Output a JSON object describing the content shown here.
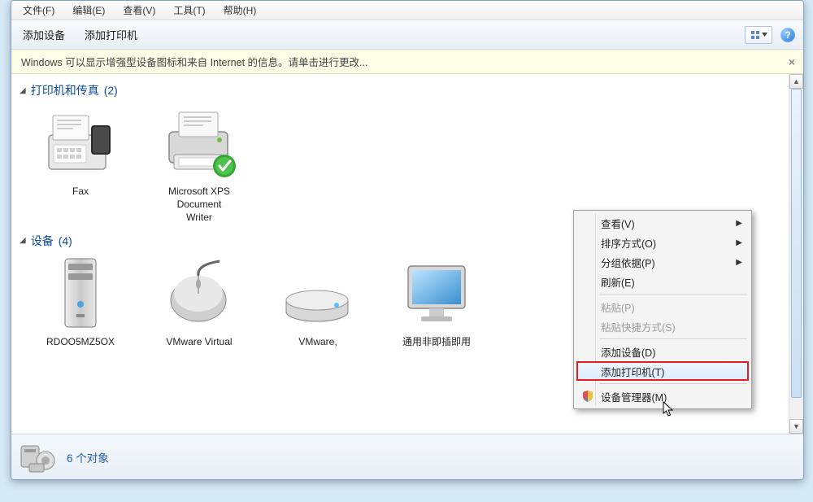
{
  "menu": {
    "file": "文件(F)",
    "edit": "编辑(E)",
    "view": "查看(V)",
    "tools": "工具(T)",
    "help": "帮助(H)"
  },
  "toolbar": {
    "add_device": "添加设备",
    "add_printer": "添加打印机"
  },
  "infobar": {
    "text": "Windows 可以显示增强型设备图标和来自 Internet 的信息。请单击进行更改...",
    "close": "×"
  },
  "groups": {
    "printers": {
      "label": "打印机和传真",
      "count": "(2)"
    },
    "devices": {
      "label": "设备",
      "count": "(4)"
    }
  },
  "items": {
    "fax": "Fax",
    "xps": "Microsoft XPS\nDocument\nWriter",
    "pc": "RDOO5MZ5OX",
    "mouse": "VMware Virtual",
    "disk": "VMware,",
    "monitor": "通用非即插即用"
  },
  "status": {
    "text": "6 个对象"
  },
  "ctx": {
    "view": "查看(V)",
    "sort": "排序方式(O)",
    "group": "分组依据(P)",
    "refresh": "刷新(E)",
    "paste": "粘贴(P)",
    "paste_shortcut": "粘贴快捷方式(S)",
    "add_device": "添加设备(D)",
    "add_printer": "添加打印机(T)",
    "device_mgr": "设备管理器(M)"
  },
  "glyphs": {
    "tri": "◢",
    "right": "▶",
    "help": "?"
  }
}
